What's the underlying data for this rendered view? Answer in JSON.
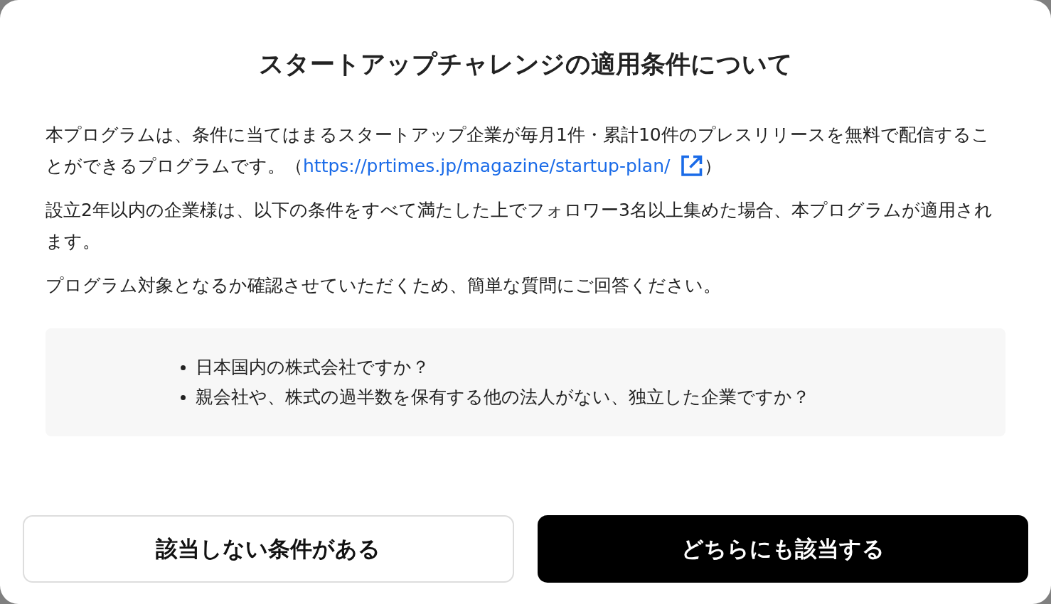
{
  "dialog": {
    "title": "スタートアップチャレンジの適用条件について",
    "intro": {
      "before": "本プログラムは、条件に当てはまるスタートアップ企業が毎月1件・累計10件のプレスリリースを無料で配信することができるプログラムです。（",
      "link": "https://prtimes.jp/magazine/startup-plan/",
      "after": "）"
    },
    "paragraphs": [
      "設立2年以内の企業様は、以下の条件をすべて満たした上でフォロワー3名以上集めた場合、本プログラムが適用されます。",
      "プログラム対象となるか確認させていただくため、簡単な質問にご回答ください。"
    ],
    "conditions": [
      "日本国内の株式会社ですか？",
      "親会社や、株式の過半数を保有する他の法人がない、独立した企業ですか？"
    ],
    "buttons": [
      {
        "label": "該当しない条件がある",
        "kind": "secondary"
      },
      {
        "label": "どちらにも該当する",
        "kind": "primary"
      }
    ]
  }
}
